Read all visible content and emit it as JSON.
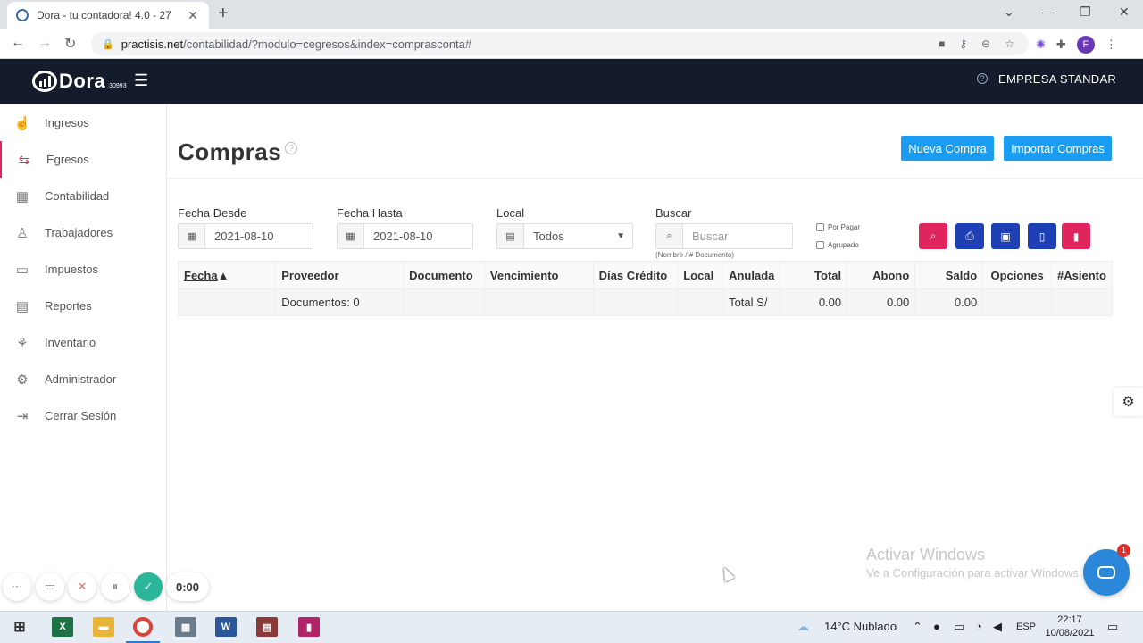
{
  "browser": {
    "tab_title": "Dora - tu contadora! 4.0 - 27",
    "url_host": "practisis.net",
    "url_path": "/contabilidad/?modulo=cegresos&index=comprasconta#",
    "profile_initial": "F"
  },
  "header": {
    "logo_text": "Dora",
    "logo_number": "30993",
    "company": "EMPRESA STANDAR"
  },
  "sidebar": {
    "items": [
      {
        "label": "Ingresos",
        "icon": "hand-coin-icon"
      },
      {
        "label": "Egresos",
        "icon": "money-out-icon"
      },
      {
        "label": "Contabilidad",
        "icon": "calculator-icon"
      },
      {
        "label": "Trabajadores",
        "icon": "users-icon"
      },
      {
        "label": "Impuestos",
        "icon": "tax-icon"
      },
      {
        "label": "Reportes",
        "icon": "report-icon"
      },
      {
        "label": "Inventario",
        "icon": "boxes-icon"
      },
      {
        "label": "Administrador",
        "icon": "gear-icon"
      },
      {
        "label": "Cerrar Sesión",
        "icon": "logout-icon"
      }
    ],
    "active": "Egresos"
  },
  "page": {
    "title": "Compras",
    "help": "?",
    "new_button": "Nueva Compra",
    "import_button": "Importar Compras"
  },
  "filters": {
    "fecha_desde_label": "Fecha Desde",
    "fecha_desde_value": "2021-08-10",
    "fecha_hasta_label": "Fecha Hasta",
    "fecha_hasta_value": "2021-08-10",
    "local_label": "Local",
    "local_value": "Todos",
    "buscar_label": "Buscar",
    "buscar_placeholder": "Buscar",
    "buscar_hint": "(Nombre / # Documento)",
    "por_pagar": "Por Pagar",
    "agrupado": "Agrupado"
  },
  "action_buttons": [
    {
      "name": "search",
      "color": "#e0245e"
    },
    {
      "name": "print",
      "color": "#1f3fb5"
    },
    {
      "name": "briefcase",
      "color": "#1f3fb5"
    },
    {
      "name": "excel",
      "color": "#1f3fb5"
    },
    {
      "name": "delete",
      "color": "#e0245e"
    }
  ],
  "table": {
    "headers": [
      "Fecha",
      "Proveedor",
      "Documento",
      "Vencimiento",
      "Días Crédito",
      "Local",
      "Anulada",
      "Total",
      "Abono",
      "Saldo",
      "Opciones",
      "#Asiento"
    ],
    "sort_indicator": "▲",
    "summary": {
      "documentos": "Documentos: 0",
      "total_label": "Total S/",
      "total": "0.00",
      "abono": "0.00",
      "saldo": "0.00"
    }
  },
  "watermark": {
    "line1": "Activar Windows",
    "line2": "Ve a Configuración para activar Windows."
  },
  "chat_badge": "1",
  "recorder": {
    "timer": "0:00"
  },
  "taskbar": {
    "weather": "14°C  Nublado",
    "language": "ESP",
    "time": "22:17",
    "date": "10/08/2021"
  }
}
